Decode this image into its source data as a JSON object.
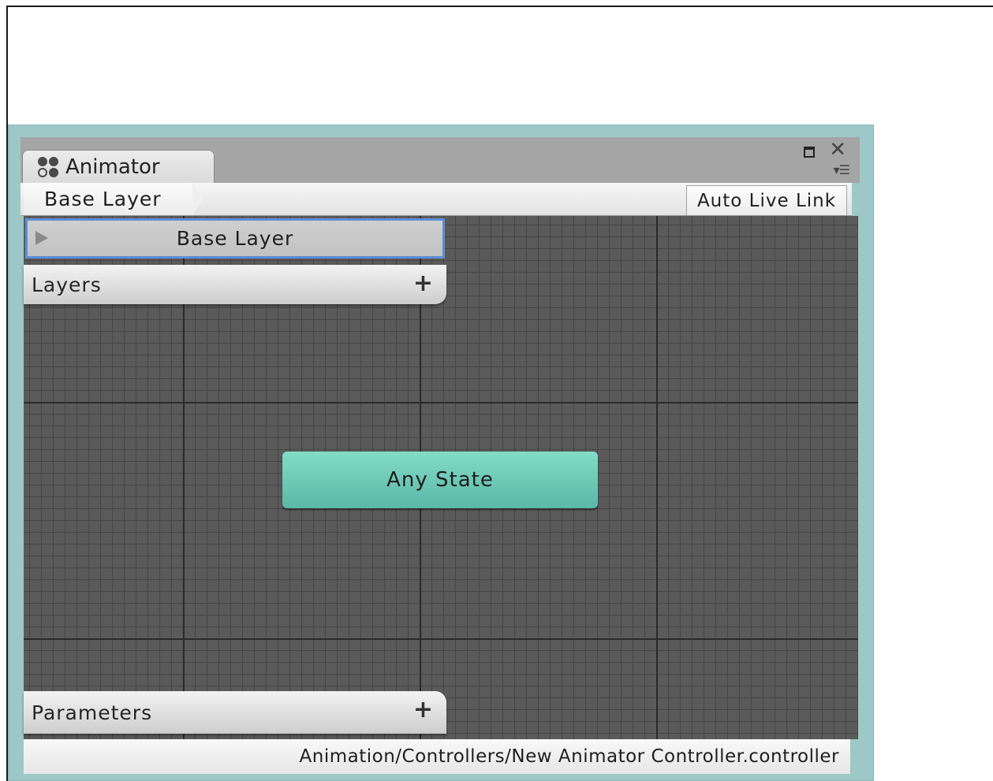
{
  "window": {
    "tab_label": "Animator",
    "tab_icon": "animator-icon",
    "controls": [
      "maximize-icon",
      "close-icon",
      "menu-icon"
    ]
  },
  "toolbar": {
    "breadcrumb": "Base Layer",
    "live_link_label": "Auto Live Link"
  },
  "layers_panel": {
    "selected_layer": "Base Layer",
    "header_label": "Layers",
    "add_label": "+"
  },
  "graph": {
    "state_label": "Any State",
    "state_color": "#6fcbb8",
    "background_color": "#5a5a5a"
  },
  "parameters_panel": {
    "header_label": "Parameters",
    "add_label": "+"
  },
  "statusbar": {
    "path": "Animation/Controllers/New Animator Controller.controller"
  },
  "colors": {
    "selection_border": "#5d8ed8",
    "window_frame": "#9ec8c8"
  }
}
